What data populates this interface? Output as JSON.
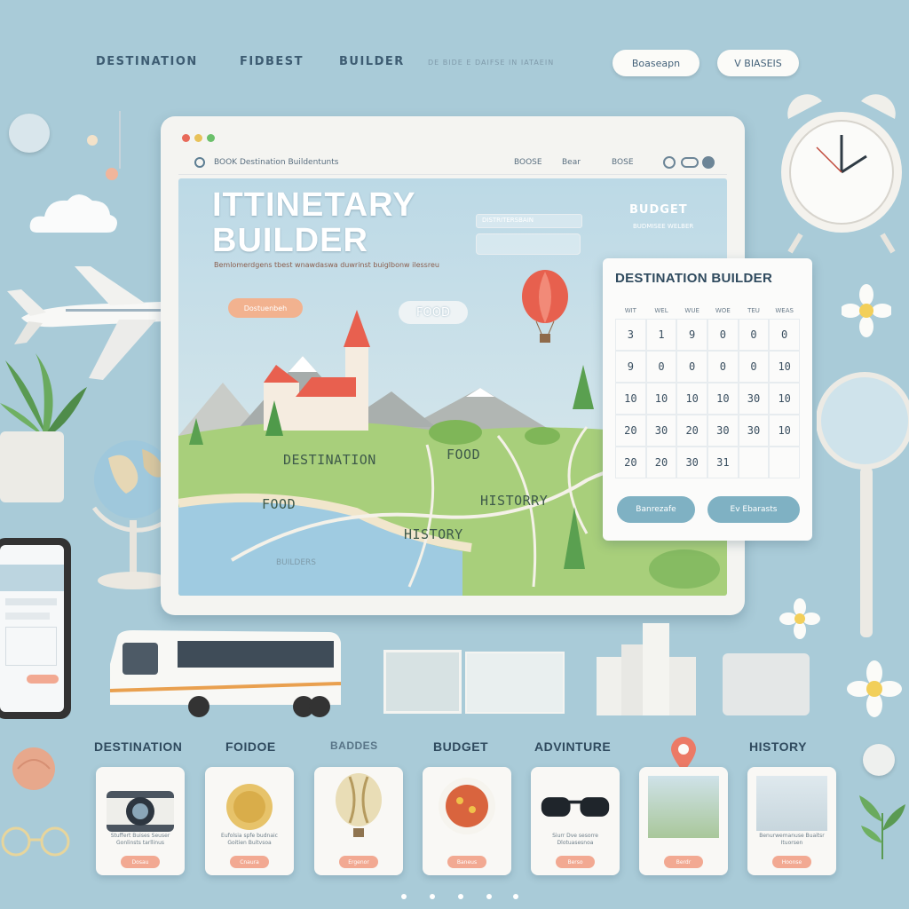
{
  "nav": {
    "items": [
      "DESTINATION",
      "FIDBEST",
      "BUILDER"
    ],
    "faint": "DE BIDE E DAIFSE IN IATAEIN",
    "btn1": "Boaseapn",
    "btn2": "V BIASEIS"
  },
  "browser": {
    "title_bar": "BOOK Destination Buildentunts",
    "menu": [
      "BOOSE",
      "Bear",
      "BOSE"
    ],
    "hero_title_1": "ITTINETARY",
    "hero_title_2": "BUILDER",
    "hero_sub": "Bemlomerdgens tbest wnawdaswa duwrinst buiglbonw ilessreu",
    "hero_btn": "Dostuenbeh",
    "form_label": "DISTRITERSBAIN",
    "budget": "BUDGET",
    "budget_sub": "BUDMISEE WELBER",
    "food_tag": "FOOD"
  },
  "map": {
    "labels": [
      "DESTINATION",
      "FOOD",
      "FOOD",
      "HISTORRY",
      "HISTORY",
      "BUILDERS"
    ]
  },
  "calendar": {
    "title": "DESTINATION BUILDER",
    "days": [
      "WIT",
      "WEL",
      "WUE",
      "WOE",
      "TEU",
      "WEAS"
    ],
    "cells": [
      "",
      "",
      "",
      "",
      "",
      "",
      "3",
      "1",
      "9",
      "0",
      "0",
      "0",
      "9",
      "0",
      "0",
      "0",
      "0",
      "10",
      "10",
      "10",
      "10",
      "10",
      "30",
      "10",
      "20",
      "30",
      "20",
      "30",
      "30",
      "10",
      "20",
      "20",
      "30",
      "31",
      "",
      ""
    ],
    "btn1": "Banrezafe",
    "btn2": "Ev Ebarasts"
  },
  "categories": [
    "DESTINATION",
    "FOIDOE",
    "BADDES",
    "BUDGET",
    "ADVINTURE",
    "HISTORY"
  ],
  "cards": [
    {
      "text": "Stuffert Buises Seuser Gonlinsts tarllinus",
      "btn": "Dosau"
    },
    {
      "text": "Eufolsia spfe budnaic Goitien Buitvsoa",
      "btn": "Cnaura"
    },
    {
      "text": "",
      "btn": "Ergenor"
    },
    {
      "text": "",
      "btn": "Baneus"
    },
    {
      "text": "Siurr Dve sesorre Dlotuasesnoa",
      "btn": "Berso"
    },
    {
      "text": "",
      "btn": "Berdr"
    },
    {
      "text": "Benurwemanuse Buaitsr Ituorsen",
      "btn": "Hoonse"
    }
  ],
  "colors": {
    "background": "#a9cbd8",
    "accent": "#f2a992",
    "teal": "#7fb1c3"
  }
}
